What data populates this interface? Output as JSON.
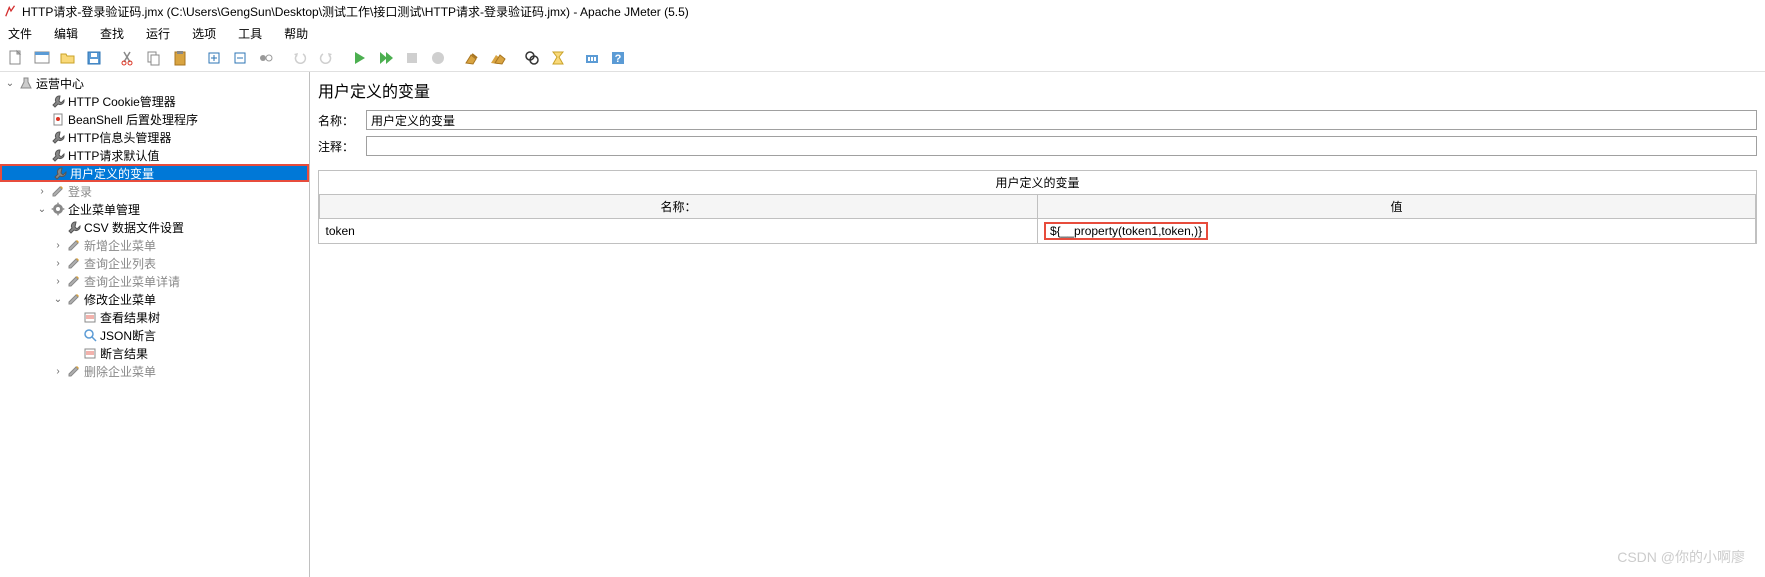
{
  "title": "HTTP请求-登录验证码.jmx (C:\\Users\\GengSun\\Desktop\\测试工作\\接口测试\\HTTP请求-登录验证码.jmx) - Apache JMeter (5.5)",
  "menu": [
    "文件",
    "编辑",
    "查找",
    "运行",
    "选项",
    "工具",
    "帮助"
  ],
  "tree": {
    "root": "运营中心",
    "items": [
      {
        "label": "HTTP Cookie管理器",
        "icon": "wrench",
        "indent": 2
      },
      {
        "label": "BeanShell 后置处理程序",
        "icon": "doc",
        "indent": 2
      },
      {
        "label": "HTTP信息头管理器",
        "icon": "wrench",
        "indent": 2
      },
      {
        "label": "HTTP请求默认值",
        "icon": "wrench",
        "indent": 2
      },
      {
        "label": "用户定义的变量",
        "icon": "wrench",
        "indent": 2,
        "selected": true,
        "highlighted": true
      },
      {
        "label": "登录",
        "icon": "pencil",
        "indent": 2,
        "grey": true,
        "caret": true
      },
      {
        "label": "企业菜单管理",
        "icon": "gear",
        "indent": 2,
        "caret": true,
        "expanded": true
      },
      {
        "label": "CSV 数据文件设置",
        "icon": "wrench",
        "indent": 3
      },
      {
        "label": "新增企业菜单",
        "icon": "pencil",
        "indent": 3,
        "grey": true,
        "caret": true
      },
      {
        "label": "查询企业列表",
        "icon": "pencil",
        "indent": 3,
        "grey": true,
        "caret": true
      },
      {
        "label": "查询企业菜单详请",
        "icon": "pencil",
        "indent": 3,
        "grey": true,
        "caret": true
      },
      {
        "label": "修改企业菜单",
        "icon": "pencil",
        "indent": 3,
        "caret": true,
        "expanded": true
      },
      {
        "label": "查看结果树",
        "icon": "result",
        "indent": 4
      },
      {
        "label": "JSON断言",
        "icon": "search",
        "indent": 4
      },
      {
        "label": "断言结果",
        "icon": "result",
        "indent": 4
      },
      {
        "label": "删除企业菜单",
        "icon": "pencil",
        "indent": 3,
        "grey": true,
        "caret": true
      }
    ]
  },
  "panel": {
    "title": "用户定义的变量",
    "name_label": "名称：",
    "name_value": "用户定义的变量",
    "comment_label": "注释：",
    "comment_value": "",
    "subtitle": "用户定义的变量",
    "col_name": "名称：",
    "col_value": "值",
    "rows": [
      {
        "name": "token",
        "value": "${__property(token1,token,)}"
      }
    ]
  },
  "watermark": "CSDN @你的小啊廖"
}
